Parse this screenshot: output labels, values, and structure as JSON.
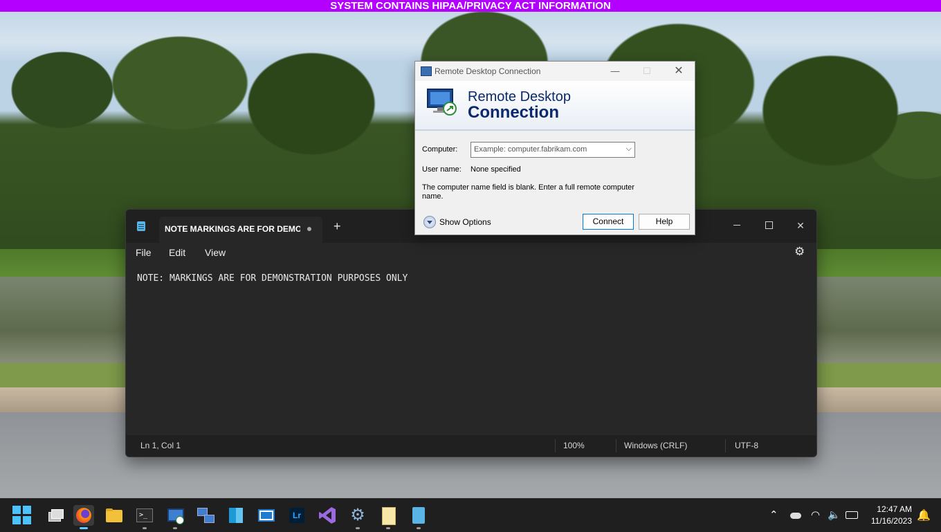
{
  "banner": {
    "text": "SYSTEM CONTAINS HIPAA/PRIVACY ACT INFORMATION",
    "color": "#b300ff"
  },
  "notepad": {
    "tab_title": "NOTE MARKINGS ARE FOR DEMON",
    "new_tab": "+",
    "menu": {
      "file": "File",
      "edit": "Edit",
      "view": "View"
    },
    "content": "NOTE: MARKINGS ARE FOR DEMONSTRATION PURPOSES ONLY",
    "status": {
      "position": "Ln 1, Col 1",
      "zoom": "100%",
      "line_ending": "Windows (CRLF)",
      "encoding": "UTF-8"
    },
    "icons": {
      "app": "notepad-icon",
      "settings": "gear-icon"
    }
  },
  "rdc": {
    "window_title": "Remote Desktop Connection",
    "header_line1": "Remote Desktop",
    "header_line2": "Connection",
    "computer_label": "Computer:",
    "computer_placeholder": "Example: computer.fabrikam.com",
    "user_label": "User name:",
    "user_value": "None specified",
    "message": "The computer name field is blank. Enter a full remote computer name.",
    "show_options": "Show Options",
    "connect": "Connect",
    "help": "Help"
  },
  "taskbar": {
    "apps": [
      "start",
      "task-view",
      "firefox",
      "file-explorer",
      "terminal",
      "remote-desktop",
      "network",
      "azure",
      "photos",
      "lightroom",
      "visual-studio",
      "settings",
      "notes",
      "notepad"
    ],
    "lightroom_label": "Lr",
    "clock_time": "12:47 AM",
    "clock_date": "11/16/2023"
  }
}
